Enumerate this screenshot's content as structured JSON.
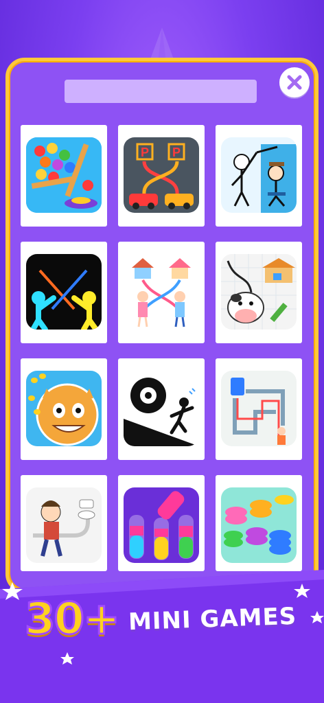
{
  "promo": {
    "count": "30+",
    "text": "MINI GAMES"
  },
  "games": [
    {
      "name": "ball-sort-pin-icon"
    },
    {
      "name": "parking-draw-icon"
    },
    {
      "name": "stickman-puzzle-icon"
    },
    {
      "name": "stickman-fight-icon"
    },
    {
      "name": "draw-home-path-icon"
    },
    {
      "name": "cow-path-icon"
    },
    {
      "name": "doge-bees-icon"
    },
    {
      "name": "saw-escape-icon"
    },
    {
      "name": "toilet-maze-icon"
    },
    {
      "name": "toilet-rush-icon"
    },
    {
      "name": "water-sort-icon"
    },
    {
      "name": "coin-sort-icon"
    }
  ],
  "colors": {
    "background": "#7b3ff0",
    "panel_border": "#ffc93a",
    "title_yellow": "#ffd21f"
  }
}
